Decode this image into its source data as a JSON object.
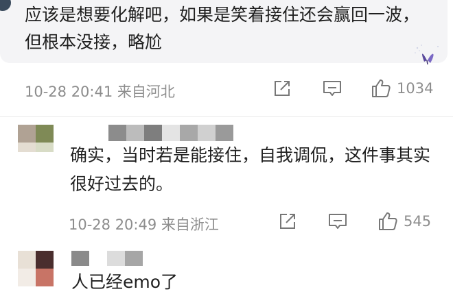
{
  "comment_main": {
    "text": "应该是想要化解吧，如果是笑着接住还会赢回一波，但根本没接，略尬",
    "meta": "10-28 20:41 来自河北",
    "like_count": "1034",
    "decoration_icon": "butterfly-icon"
  },
  "reply_1": {
    "text": "确实，当时若是能接住，自我调侃，这件事其实很好过去的。",
    "meta": "10-28 20:49 来自浙江",
    "like_count": "545",
    "avatar_state": "mosaic-blurred",
    "username_state": "mosaic-blurred"
  },
  "reply_2": {
    "text": "人已经emo了",
    "avatar_state": "mosaic-blurred",
    "username_state": "mosaic-blurred"
  },
  "icons": {
    "repost": "share-edit-icon",
    "comment": "comment-icon",
    "like": "thumbs-up-icon"
  },
  "colors": {
    "bubble_bg": "#f4f4f6",
    "meta_text": "#8d8d8d",
    "body_text": "#1f1f1f"
  }
}
